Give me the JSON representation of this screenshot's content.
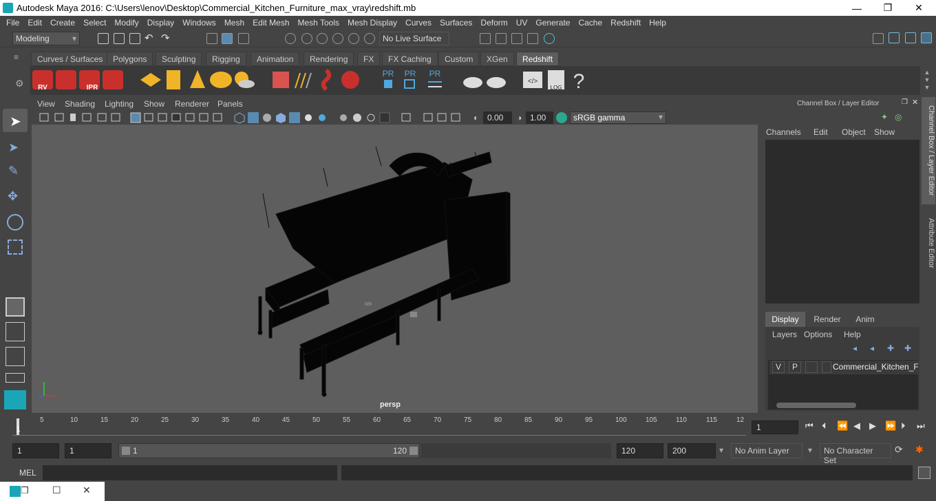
{
  "window": {
    "title": "Autodesk Maya 2016: C:\\Users\\lenov\\Desktop\\Commercial_Kitchen_Furniture_max_vray\\redshift.mb",
    "minimize": "—",
    "maximize": "❐",
    "close": "✕"
  },
  "menu": [
    "File",
    "Edit",
    "Create",
    "Select",
    "Modify",
    "Display",
    "Windows",
    "Mesh",
    "Edit Mesh",
    "Mesh Tools",
    "Mesh Display",
    "Curves",
    "Surfaces",
    "Deform",
    "UV",
    "Generate",
    "Cache",
    "Redshift",
    "Help"
  ],
  "status": {
    "mode": "Modeling",
    "live_surface": "No Live Surface"
  },
  "shelf_tabs": [
    "Curves / Surfaces",
    "Polygons",
    "Sculpting",
    "Rigging",
    "Animation",
    "Rendering",
    "FX",
    "FX Caching",
    "Custom",
    "XGen",
    "Redshift"
  ],
  "active_shelf_tab": "Redshift",
  "shelf_labels": {
    "rv": "RV",
    "ipr": "IPR",
    "pr1": "PR",
    "pr2": "PR",
    "pr3": "PR",
    "log": "LOG",
    "help": "?"
  },
  "panel_menu": [
    "View",
    "Shading",
    "Lighting",
    "Show",
    "Renderer",
    "Panels"
  ],
  "viewport": {
    "exposure": "0.00",
    "gamma": "1.00",
    "color_space": "sRGB gamma",
    "camera": "persp"
  },
  "channel_box": {
    "title": "Channel Box / Layer Editor",
    "menu": [
      "Channels",
      "Edit",
      "Object",
      "Show"
    ]
  },
  "layer_editor": {
    "tabs": [
      "Display",
      "Render",
      "Anim"
    ],
    "active_tab": "Display",
    "menu": [
      "Layers",
      "Options",
      "Help"
    ],
    "layer": {
      "v": "V",
      "p": "P",
      "name": "Commercial_Kitchen_Fur"
    }
  },
  "side_tabs": {
    "channel_box": "Channel Box / Layer Editor",
    "attribute_editor": "Attribute Editor"
  },
  "timeline": {
    "ticks": [
      "5",
      "10",
      "15",
      "20",
      "25",
      "30",
      "35",
      "40",
      "45",
      "50",
      "55",
      "60",
      "65",
      "70",
      "75",
      "80",
      "85",
      "90",
      "95",
      "100",
      "105",
      "110",
      "115",
      "12"
    ],
    "current_frame": "1",
    "start_marker": "1"
  },
  "range": {
    "start": "1",
    "playback_start": "1",
    "slider_start": "1",
    "slider_end": "120",
    "playback_end": "120",
    "end": "200",
    "anim_layer": "No Anim Layer",
    "character_set": "No Character Set"
  },
  "mel": {
    "label": "MEL"
  },
  "taskbar": {
    "restore": "❐",
    "maximize": "☐",
    "close": "✕"
  }
}
